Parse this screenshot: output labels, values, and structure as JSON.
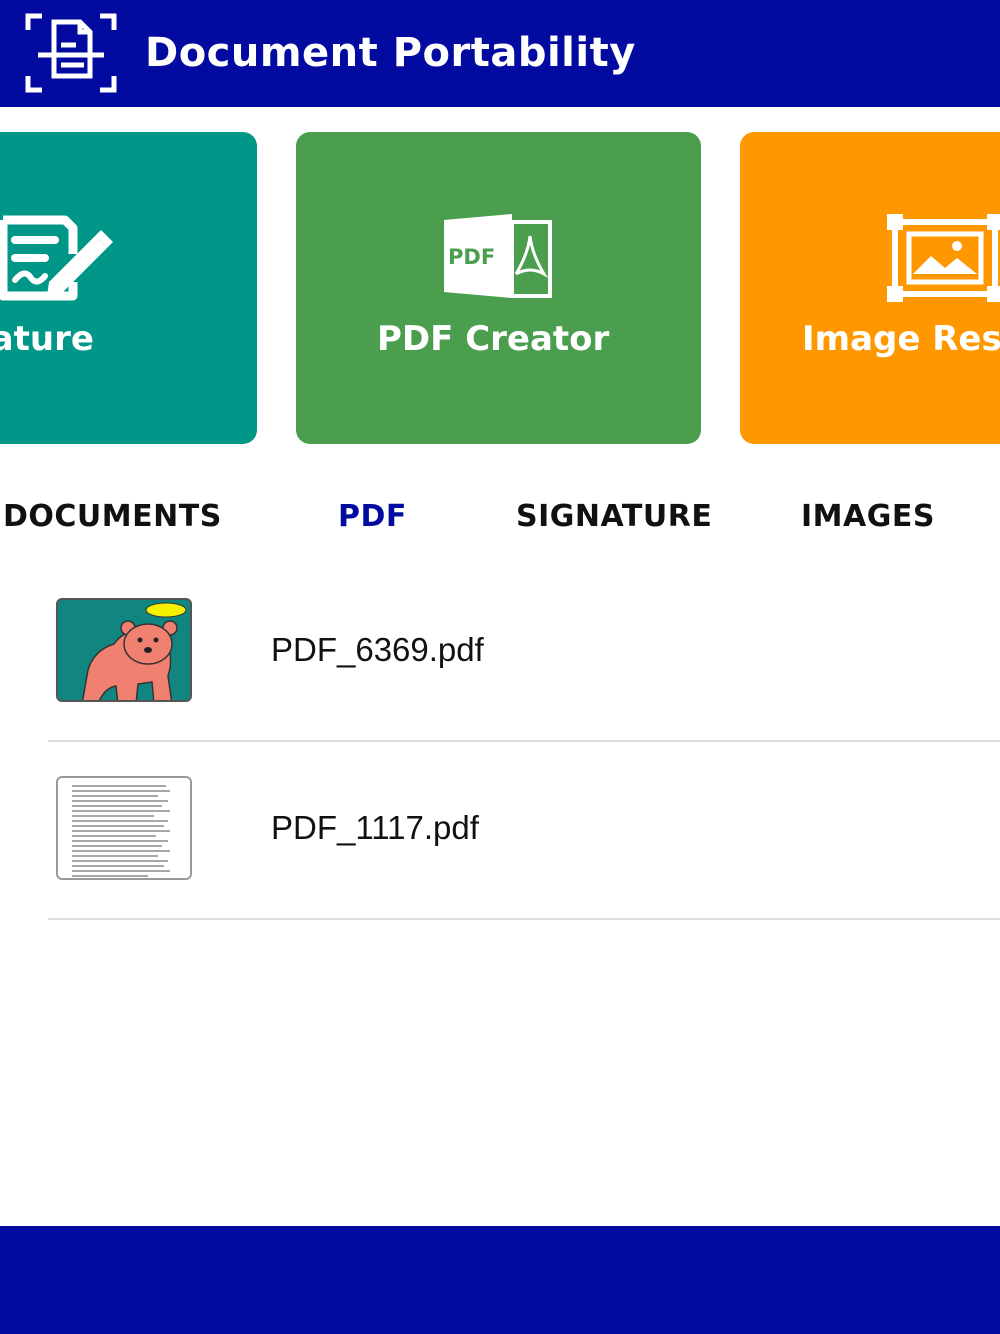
{
  "header": {
    "title": "Document Portability",
    "icon": "scanned-document-icon"
  },
  "cards": [
    {
      "label": "Signature",
      "icon": "signature-pen-icon",
      "color": "#009688"
    },
    {
      "label": "PDF Creator",
      "icon": "pdf-file-icon",
      "icon_text": "PDF",
      "color": "#4a9e4e"
    },
    {
      "label": "Image Resizer",
      "icon": "image-resize-icon",
      "color": "#ff9800"
    }
  ],
  "tabs": [
    {
      "label": "DOCUMENTS",
      "active": false
    },
    {
      "label": "PDF",
      "active": true
    },
    {
      "label": "SIGNATURE",
      "active": false
    },
    {
      "label": "IMAGES",
      "active": false
    }
  ],
  "files": [
    {
      "name": "PDF_6369.pdf",
      "thumbnail": "bear-thumbnail"
    },
    {
      "name": "PDF_1117.pdf",
      "thumbnail": "text-page-thumbnail"
    }
  ],
  "colors": {
    "primary": "#020aa0",
    "teal": "#009688",
    "green": "#4a9e4e",
    "orange": "#ff9800"
  }
}
